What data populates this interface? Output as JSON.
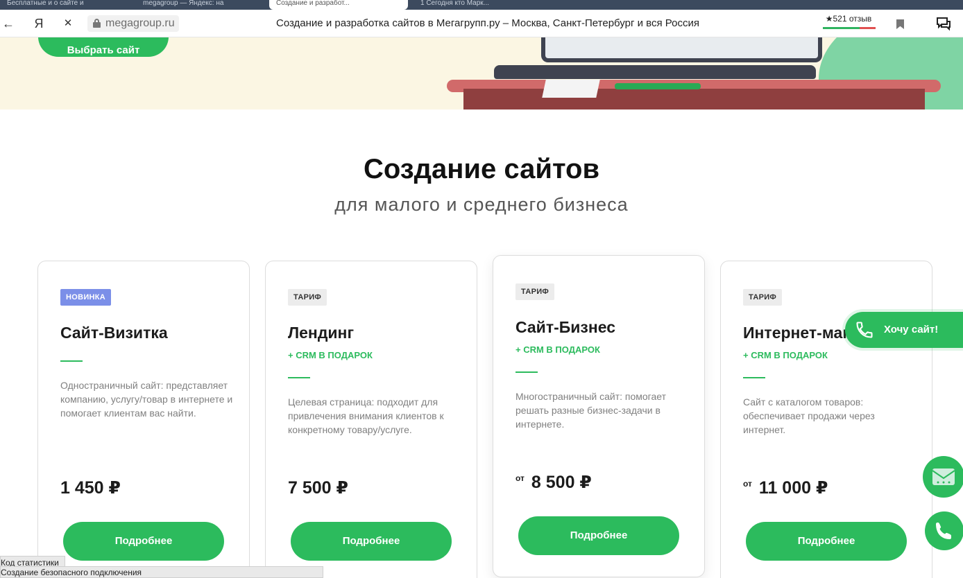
{
  "browser": {
    "tabs": [
      {
        "label": "Бесплатные и о сайте и"
      },
      {
        "label": "megagroup — Яндекс: на"
      },
      {
        "label": "Создание и разработ..."
      },
      {
        "label": "1 Сегодня кто Марк..."
      }
    ],
    "back_label": "←",
    "yandex_label": "Я",
    "stop_label": "✕",
    "url": "megagroup.ru",
    "page_title": "Создание и разработка сайтов в Мегагрупп.ру – Москва, Санкт-Петербург и вся Россия",
    "reviews": "★521 отзыв"
  },
  "hero": {
    "cta_label": "Выбрать сайт"
  },
  "section": {
    "title": "Создание сайтов",
    "subtitle": "для малого и среднего бизнеса"
  },
  "cards": [
    {
      "badge": "НОВИНКА",
      "title": "Сайт-Визитка",
      "crm": "",
      "description": "Одностраничный сайт: представляет компанию, услугу/товар в интернете и помогает клиентам вас найти.",
      "price_prefix": "",
      "price": "1 450 ₽",
      "button": "Подробнее"
    },
    {
      "badge": "ТАРИФ",
      "title": "Лендинг",
      "crm": "+ CRM В ПОДАРОК",
      "description": "Целевая страница: подходит для привлечения внимания клиентов к конкретному товару/услуге.",
      "price_prefix": "",
      "price": "7 500 ₽",
      "button": "Подробнее"
    },
    {
      "badge": "ТАРИФ",
      "title": "Сайт-Бизнес",
      "crm": "+ CRM В ПОДАРОК",
      "description": "Многостраничный сайт: помогает решать разные бизнес-задачи в интернете.",
      "price_prefix": "от",
      "price": "8 500 ₽",
      "button": "Подробнее"
    },
    {
      "badge": "ТАРИФ",
      "title": "Интернет-магазин",
      "crm": "+ CRM В ПОДАРОК",
      "description": "Сайт с каталогом товаров: обеспечивает продажи через интернет.",
      "price_prefix": "от",
      "price": "11 000 ₽",
      "button": "Подробнее"
    }
  ],
  "widgets": {
    "want_site": "Хочу сайт!"
  },
  "statusbar": {
    "line1": "Код статистики",
    "line2": "Создание безопасного подключения"
  },
  "colors": {
    "accent_green": "#2cbb5d",
    "new_badge": "#7b8fe8",
    "hero_bg": "#fbf6e3"
  }
}
